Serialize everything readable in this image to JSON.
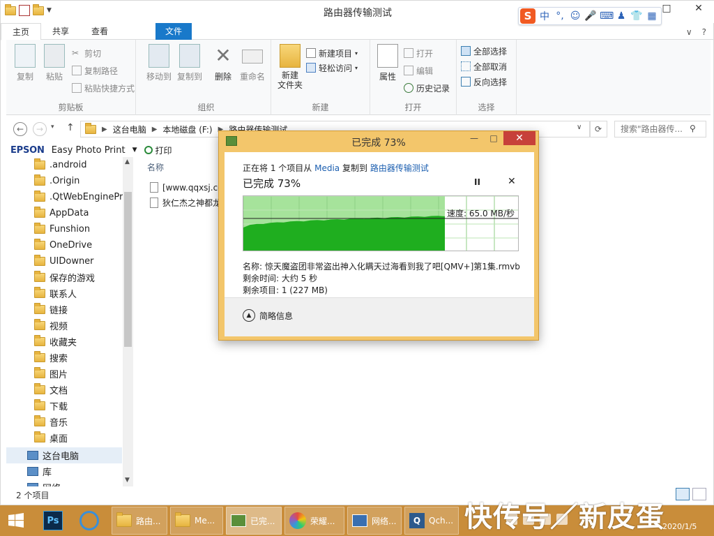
{
  "window": {
    "title": "路由器传输测试",
    "controls": {
      "minimize": "—",
      "maximize": "□",
      "close": "✕"
    }
  },
  "ime": {
    "logo": "S",
    "items": [
      "中",
      "°,",
      "☺",
      "🎤",
      "⌨",
      "♟",
      "👕",
      "▦"
    ]
  },
  "ribbon_tabs": [
    "文件",
    "主页",
    "共享",
    "查看"
  ],
  "ribbon_help": {
    "chevron": "∨",
    "help": "?"
  },
  "ribbon": {
    "clipboard": {
      "label": "剪贴板",
      "copy": "复制",
      "paste": "粘贴",
      "cut": "剪切",
      "copy_path": "复制路径",
      "paste_shortcut": "粘贴快捷方式"
    },
    "organize": {
      "label": "组织",
      "move_to": "移动到",
      "copy_to": "复制到",
      "delete": "删除",
      "rename": "重命名"
    },
    "new": {
      "label": "新建",
      "new_folder": "新建\n文件夹",
      "new_item": "新建项目",
      "easy_access": "轻松访问"
    },
    "open": {
      "label": "打开",
      "properties": "属性",
      "open": "打开",
      "edit": "编辑",
      "history": "历史记录"
    },
    "select": {
      "label": "选择",
      "select_all": "全部选择",
      "select_none": "全部取消",
      "invert": "反向选择"
    }
  },
  "address": {
    "crumbs": [
      "这台电脑",
      "本地磁盘 (F:)",
      "路由器传输测试"
    ],
    "search_placeholder": "搜索\"路由器传..."
  },
  "cmdbar": {
    "brand": "EPSON",
    "app": "Easy Photo Print",
    "print": "打印"
  },
  "nav_items": [
    ".android",
    ".Origin",
    ".QtWebEngineProc",
    "AppData",
    "Funshion",
    "OneDrive",
    "UIDowner",
    "保存的游戏",
    "联系人",
    "链接",
    "视频",
    "收藏夹",
    "搜索",
    "图片",
    "文档",
    "下载",
    "音乐",
    "桌面"
  ],
  "nav_pc": "这台电脑",
  "nav_lib": "库",
  "nav_net": "网络",
  "content": {
    "column_name": "名称",
    "files": [
      "[www.qqxsj.co",
      "狄仁杰之神都龙"
    ]
  },
  "status": {
    "item_count": "2 个项目"
  },
  "dialog": {
    "title": "已完成 73%",
    "copy_prefix": "正在将 1 个项目从",
    "source": "Media",
    "copy_mid": "复制到",
    "dest": "路由器传输测试",
    "percent_text": "已完成 73%",
    "pause": "II",
    "cancel": "✕",
    "speed": "速度: 65.0 MB/秒",
    "name_line": "名称: 惊天魔盗团非常盗出神入化瞒天过海看到我了吧[QMV+]第1集.rmvb",
    "time_line": "剩余时间: 大约 5 秒",
    "items_line": "剩余项目: 1 (227 MB)",
    "details": "简略信息",
    "progress": 0.73,
    "colors": {
      "frame": "#f3c66b",
      "graph_done": "#1fae1f",
      "graph_bg": "#a6e39b"
    }
  },
  "taskbar": {
    "buttons": [
      "路由...",
      "Me...",
      "已完...",
      "荣耀...",
      "网络...",
      "Qch..."
    ],
    "clock_date": "2020/1/5"
  },
  "watermark": "快传号／新皮蛋"
}
